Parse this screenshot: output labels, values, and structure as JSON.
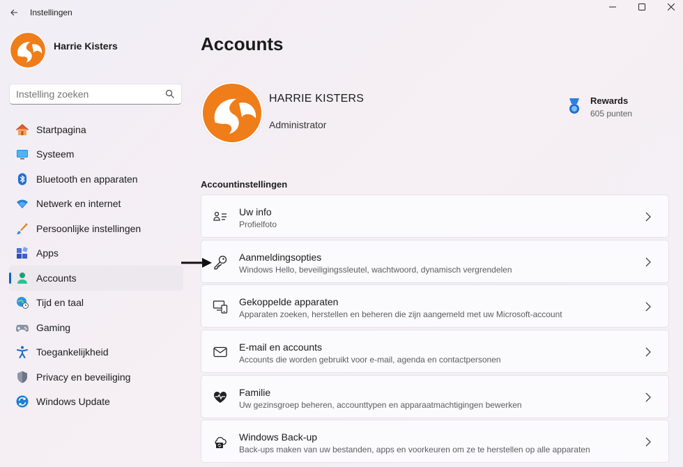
{
  "window": {
    "title": "Instellingen"
  },
  "profile": {
    "name": "Harrie Kisters"
  },
  "search": {
    "placeholder": "Instelling zoeken"
  },
  "nav": {
    "items": [
      {
        "label": "Startpagina",
        "icon": "home-icon"
      },
      {
        "label": "Systeem",
        "icon": "monitor-icon"
      },
      {
        "label": "Bluetooth en apparaten",
        "icon": "bluetooth-icon"
      },
      {
        "label": "Netwerk en internet",
        "icon": "wifi-icon"
      },
      {
        "label": "Persoonlijke instellingen",
        "icon": "brush-icon"
      },
      {
        "label": "Apps",
        "icon": "apps-icon"
      },
      {
        "label": "Accounts",
        "icon": "person-icon",
        "active": true
      },
      {
        "label": "Tijd en taal",
        "icon": "globe-clock-icon"
      },
      {
        "label": "Gaming",
        "icon": "gamepad-icon"
      },
      {
        "label": "Toegankelijkheid",
        "icon": "accessibility-icon"
      },
      {
        "label": "Privacy en beveiliging",
        "icon": "shield-icon"
      },
      {
        "label": "Windows Update",
        "icon": "update-icon"
      }
    ]
  },
  "main": {
    "title": "Accounts",
    "user": {
      "name": "HARRIE KISTERS",
      "role": "Administrator"
    },
    "rewards": {
      "title": "Rewards",
      "points": "605 punten"
    },
    "section_label": "Accountinstellingen",
    "cards": [
      {
        "title": "Uw info",
        "subtitle": "Profielfoto",
        "icon": "contact-card-icon"
      },
      {
        "title": "Aanmeldingsopties",
        "subtitle": "Windows Hello, beveiligingssleutel, wachtwoord, dynamisch vergrendelen",
        "icon": "key-icon"
      },
      {
        "title": "Gekoppelde apparaten",
        "subtitle": "Apparaten zoeken, herstellen en beheren die zijn aangemeld met uw Microsoft-account",
        "icon": "devices-icon"
      },
      {
        "title": "E-mail en accounts",
        "subtitle": "Accounts die worden gebruikt voor e-mail, agenda en contactpersonen",
        "icon": "mail-icon"
      },
      {
        "title": "Familie",
        "subtitle": "Uw gezinsgroep beheren, accounttypen en apparaatmachtigingen bewerken",
        "icon": "family-heart-icon"
      },
      {
        "title": "Windows Back-up",
        "subtitle": "Back-ups maken van uw bestanden, apps en voorkeuren om ze te herstellen op alle apparaten",
        "icon": "backup-icon"
      }
    ]
  },
  "colors": {
    "accent": "#0067c0",
    "avatar_orange": "#ef7d1a"
  }
}
